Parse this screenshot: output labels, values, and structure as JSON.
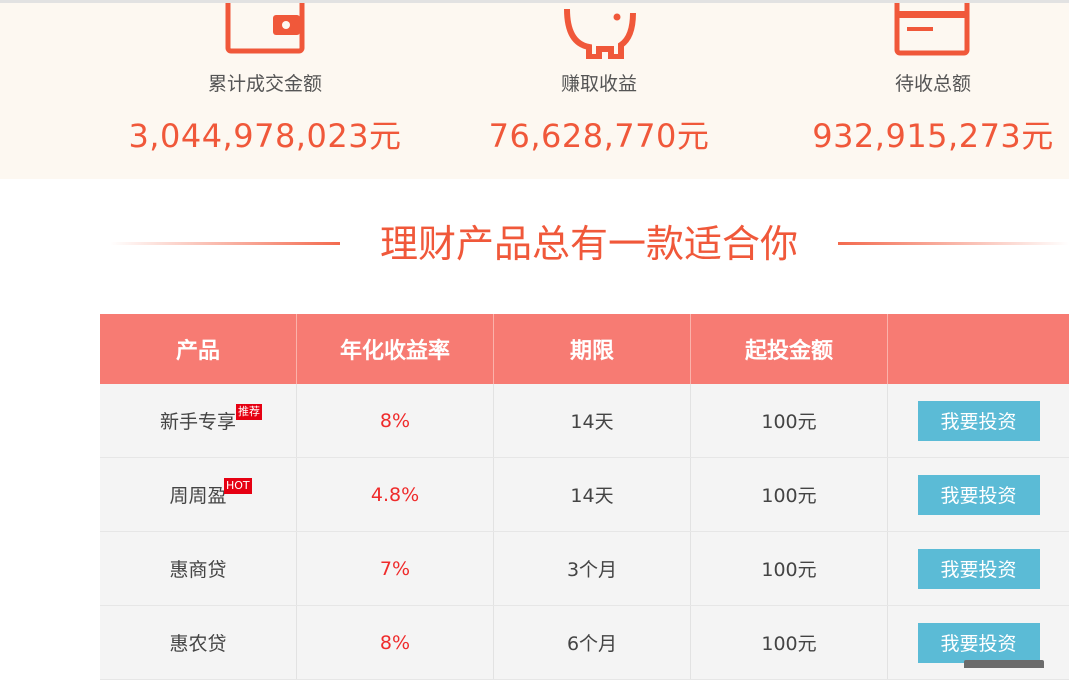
{
  "stats": [
    {
      "label": "累计成交金额",
      "value": "3,044,978,023元",
      "icon": "wallet-icon"
    },
    {
      "label": "赚取收益",
      "value": "76,628,770元",
      "icon": "piggy-bank-icon"
    },
    {
      "label": "待收总额",
      "value": "932,915,273元",
      "icon": "card-icon"
    }
  ],
  "section_title": "理财产品总有一款适合你",
  "table": {
    "headers": [
      "产品",
      "年化收益率",
      "期限",
      "起投金额",
      ""
    ],
    "rows": [
      {
        "name": "新手专享",
        "badge": "推荐",
        "rate": "8%",
        "term": "14天",
        "min": "100元",
        "action": "我要投资"
      },
      {
        "name": "周周盈",
        "badge": "HOT",
        "rate": "4.8%",
        "term": "14天",
        "min": "100元",
        "action": "我要投资"
      },
      {
        "name": "惠商贷",
        "badge": "",
        "rate": "7%",
        "term": "3个月",
        "min": "100元",
        "action": "我要投资"
      },
      {
        "name": "惠农贷",
        "badge": "",
        "rate": "8%",
        "term": "6个月",
        "min": "100元",
        "action": "我要投资"
      }
    ]
  },
  "colors": {
    "accent": "#f0583a",
    "table_header": "#f77b73",
    "rate_text": "#ef2b2b",
    "button": "#5bbbd6",
    "badge": "#e60012"
  }
}
